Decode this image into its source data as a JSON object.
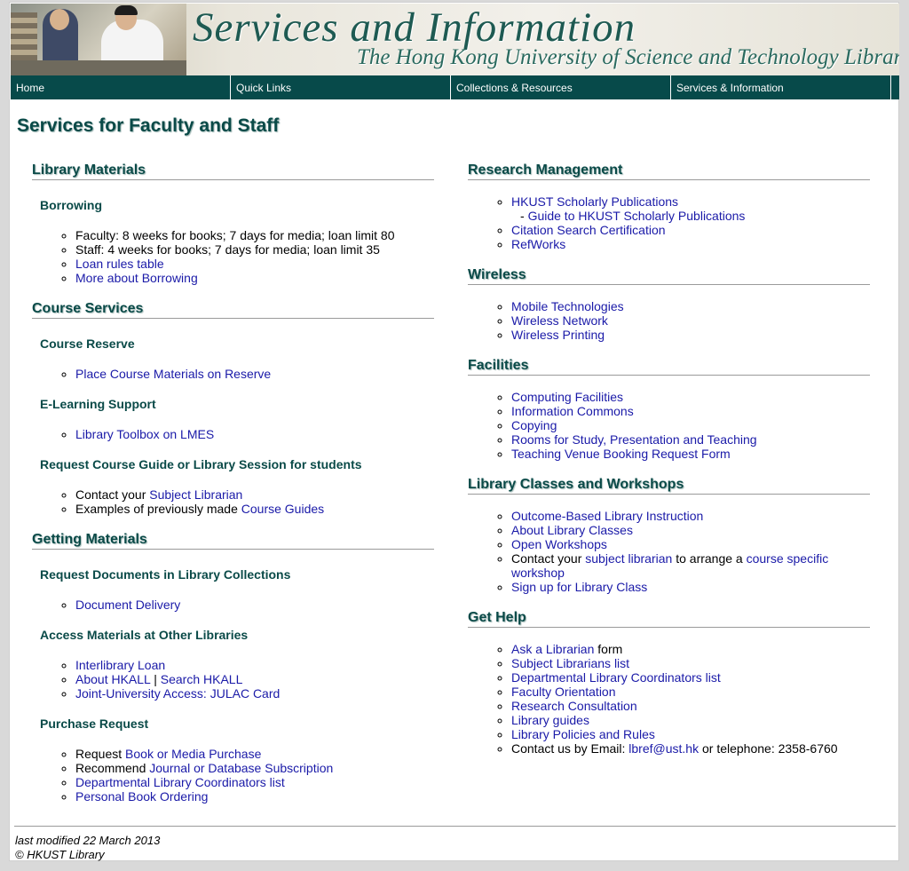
{
  "banner": {
    "title": "Services and Information",
    "subtitle": "The Hong Kong University of Science and Technology Library"
  },
  "nav": {
    "items": [
      "Home",
      "Quick Links",
      "Collections & Resources",
      "Services & Information"
    ]
  },
  "page_title": "Services for Faculty and Staff",
  "left": {
    "library_materials": {
      "heading": "Library Materials",
      "borrowing": {
        "heading": "Borrowing",
        "faculty": "Faculty: 8 weeks for books; 7 days for media; loan limit 80",
        "staff": "Staff: 4 weeks for books; 7 days for media; loan limit 35",
        "loan_rules": "Loan rules table",
        "more_borrowing": "More about Borrowing"
      }
    },
    "course_services": {
      "heading": "Course Services",
      "course_reserve": {
        "heading": "Course Reserve",
        "place": "Place Course Materials on Reserve"
      },
      "elearning": {
        "heading": "E-Learning Support",
        "toolbox": "Library Toolbox on LMES"
      },
      "request_guide": {
        "heading": "Request Course Guide or Library Session for students",
        "contact_prefix": "Contact your ",
        "contact_link": "Subject Librarian",
        "examples_prefix": "Examples of previously made ",
        "examples_link": "Course Guides"
      }
    },
    "getting_materials": {
      "heading": "Getting Materials",
      "request_docs": {
        "heading": "Request Documents in Library Collections",
        "delivery": "Document Delivery"
      },
      "other_libraries": {
        "heading": "Access Materials at Other Libraries",
        "ill": "Interlibrary Loan",
        "about_hkall": "About HKALL",
        "sep": " | ",
        "search_hkall": "Search HKALL",
        "julac": "Joint-University Access: JULAC Card"
      },
      "purchase": {
        "heading": "Purchase Request",
        "request_prefix": "Request ",
        "request_link": "Book or Media Purchase",
        "recommend_prefix": "Recommend ",
        "recommend_link": "Journal or Database Subscription",
        "coordinators": "Departmental Library Coordinators list",
        "personal": "Personal Book Ordering"
      }
    }
  },
  "right": {
    "research": {
      "heading": "Research Management",
      "scholarly": "HKUST Scholarly Publications",
      "guide_prefix": "- ",
      "guide": "Guide to HKUST Scholarly Publications",
      "citation": "Citation Search Certification",
      "refworks": "RefWorks"
    },
    "wireless": {
      "heading": "Wireless",
      "mobile": "Mobile Technologies",
      "network": "Wireless Network",
      "printing": "Wireless Printing"
    },
    "facilities": {
      "heading": "Facilities",
      "computing": "Computing Facilities",
      "commons": "Information Commons",
      "copying": "Copying",
      "rooms": "Rooms for Study, Presentation and Teaching",
      "venue": "Teaching Venue Booking Request Form"
    },
    "classes": {
      "heading": "Library Classes and Workshops",
      "obli": "Outcome-Based Library Instruction",
      "about": "About Library Classes",
      "open": "Open Workshops",
      "contact_prefix": "Contact your ",
      "contact_link": "subject librarian",
      "contact_mid": " to arrange a ",
      "contact_link2": "course specific workshop",
      "signup": "Sign up for Library Class"
    },
    "help": {
      "heading": "Get Help",
      "ask": "Ask a Librarian",
      "ask_suffix": " form",
      "subject": "Subject Librarians list",
      "dept": "Departmental Library Coordinators list",
      "orientation": "Faculty Orientation",
      "consult": "Research Consultation",
      "guides": "Library guides",
      "policies": "Library Policies and Rules",
      "contact_prefix": "Contact us by Email: ",
      "email": "lbref@ust.hk",
      "contact_suffix": " or telephone: 2358-6760"
    }
  },
  "footer": {
    "modified": "last modified 22 March 2013",
    "copyright": "© HKUST Library"
  },
  "colors": {
    "nav_bg": "#074a4a",
    "heading": "#0a4a48",
    "link": "#1a1aa8"
  }
}
